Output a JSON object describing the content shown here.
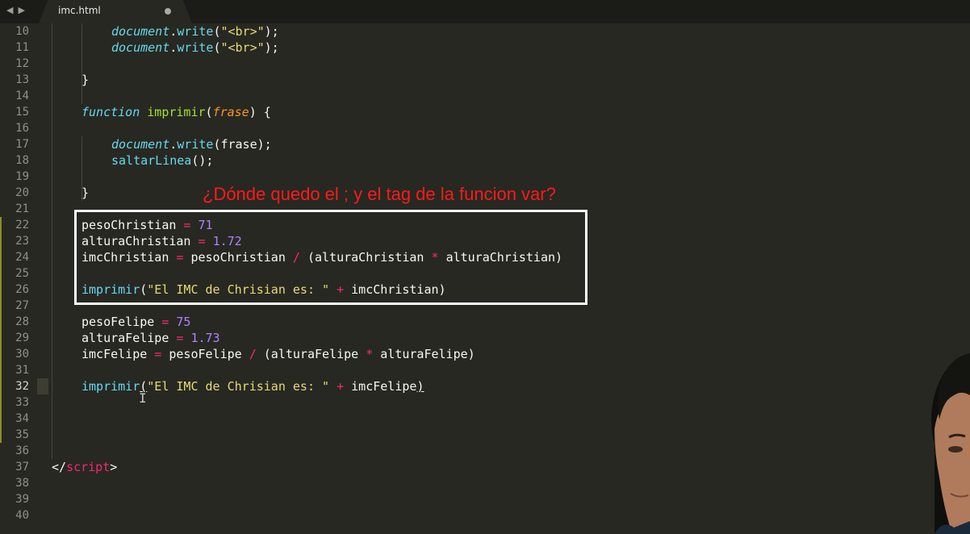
{
  "tab": {
    "title": "imc.html",
    "nav_back": "◀",
    "nav_fwd": "▶"
  },
  "annotation": "¿Dónde quedo el ; y el tag de la funcion var?",
  "lines": [
    {
      "n": "10"
    },
    {
      "n": "11"
    },
    {
      "n": "12"
    },
    {
      "n": "13"
    },
    {
      "n": "14"
    },
    {
      "n": "15"
    },
    {
      "n": "16"
    },
    {
      "n": "17"
    },
    {
      "n": "18"
    },
    {
      "n": "19"
    },
    {
      "n": "20"
    },
    {
      "n": "21"
    },
    {
      "n": "22"
    },
    {
      "n": "23"
    },
    {
      "n": "24"
    },
    {
      "n": "25"
    },
    {
      "n": "26"
    },
    {
      "n": "27"
    },
    {
      "n": "28"
    },
    {
      "n": "29"
    },
    {
      "n": "30"
    },
    {
      "n": "31"
    },
    {
      "n": "32"
    },
    {
      "n": "33"
    },
    {
      "n": "34"
    },
    {
      "n": "35"
    },
    {
      "n": "36"
    },
    {
      "n": "37"
    },
    {
      "n": "38"
    },
    {
      "n": "39"
    },
    {
      "n": "40"
    }
  ],
  "code": {
    "l10": {
      "obj": "document",
      "dot": ".",
      "fn": "write",
      "p1": "(",
      "str": "\"<br>\"",
      "p2": ");"
    },
    "l11": {
      "obj": "document",
      "dot": ".",
      "fn": "write",
      "p1": "(",
      "str": "\"<br>\"",
      "p2": ");"
    },
    "l13": {
      "txt": "}"
    },
    "l15": {
      "kw": "function",
      "sp": " ",
      "name": "imprimir",
      "p1": "(",
      "param": "frase",
      "p2": ") {"
    },
    "l17": {
      "obj": "document",
      "dot": ".",
      "fn": "write",
      "rest": "(frase);"
    },
    "l18": {
      "fn": "saltarLinea",
      "rest": "();"
    },
    "l20": {
      "txt": "}"
    },
    "l22": {
      "v": "pesoChristian",
      "eq": " = ",
      "num": "71"
    },
    "l23": {
      "v": "alturaChristian",
      "eq": " = ",
      "num": "1.72"
    },
    "l24": {
      "v": "imcChristian",
      "eq": " = ",
      "a": "pesoChristian",
      "op1": " / ",
      "b": "(alturaChristian",
      "op2": " * ",
      "c": "alturaChristian)"
    },
    "l26": {
      "fn": "imprimir",
      "p1": "(",
      "str": "\"El IMC de Chrisian es: \"",
      "op": " + ",
      "rest": "imcChristian)"
    },
    "l28": {
      "v": "pesoFelipe",
      "eq": " = ",
      "num": "75"
    },
    "l29": {
      "v": "alturaFelipe",
      "eq": " = ",
      "num": "1.73"
    },
    "l30": {
      "v": "imcFelipe",
      "eq": " = ",
      "a": "pesoFelipe",
      "op1": " / ",
      "b": "(alturaFelipe",
      "op2": " * ",
      "c": "alturaFelipe)"
    },
    "l32": {
      "fn": "imprimir",
      "p1": "(",
      "str": "\"El IMC de Chrisian es: \"",
      "op": " + ",
      "rest": "imcFelipe",
      "p2": ")"
    },
    "l37": {
      "open": "</",
      "tag": "script",
      "close": ">"
    }
  },
  "colors": {
    "background": "#272822",
    "keyword": "#66d9ef",
    "string": "#e6db74",
    "number": "#ae81ff",
    "operator": "#f92672",
    "function_name": "#a6e22e",
    "parameter": "#fd971f",
    "annotation": "#ff1a1a"
  },
  "active_line": "32"
}
